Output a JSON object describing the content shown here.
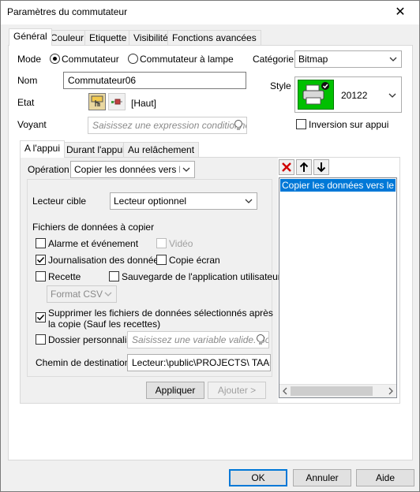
{
  "window": {
    "title": "Paramètres du commutateur",
    "close_glyph": "✕"
  },
  "tabs": [
    {
      "label": "Général",
      "active": true
    },
    {
      "label": "Couleur"
    },
    {
      "label": "Etiquette"
    },
    {
      "label": "Visibilité"
    },
    {
      "label": "Fonctions avancées"
    }
  ],
  "general": {
    "mode_label": "Mode",
    "mode_options": [
      "Commutateur",
      "Commutateur à lampe"
    ],
    "mode_selected": "Commutateur",
    "categorie_label": "Catégorie",
    "categorie_value": "Bitmap",
    "nom_label": "Nom",
    "nom_value": "Commutateur06",
    "style_label": "Style",
    "style_value": "20122",
    "etat_label": "Etat",
    "etat_value": "[Haut]",
    "voyant_label": "Voyant",
    "voyant_placeholder": "Saisissez une expression conditionne",
    "inversion_label": "Inversion sur appui"
  },
  "action_tabs": [
    {
      "label": "A l'appui",
      "active": true
    },
    {
      "label": "Durant l'appui"
    },
    {
      "label": "Au relâchement"
    }
  ],
  "action": {
    "operation_label": "Opération",
    "operation_value": "Copier les données vers le le",
    "lecteur_label": "Lecteur cible",
    "lecteur_value": "Lecteur optionnel",
    "fichiers_label": "Fichiers de données à copier",
    "checkboxes": {
      "alarme": {
        "label": "Alarme et événement",
        "checked": false
      },
      "video": {
        "label": "Vidéo",
        "checked": false,
        "disabled": true
      },
      "journalisation": {
        "label": "Journalisation des données",
        "checked": true
      },
      "copie_ecran": {
        "label": "Copie écran",
        "checked": false
      },
      "recette": {
        "label": "Recette",
        "checked": false
      },
      "sauvegarde": {
        "label": "Sauvegarde de l'application utilisateur",
        "checked": false
      },
      "supprimer": {
        "label_line1": "Supprimer les fichiers de données sélectionnés après",
        "label_line2": "la copie (Sauf les recettes)",
        "checked": true
      },
      "dossier": {
        "label": "Dossier personnalisé",
        "checked": false
      }
    },
    "format_value": "Format CSV",
    "dossier_placeholder": "Saisissez une variable valide. So",
    "chemin_label": "Chemin de destination:",
    "chemin_value": "Lecteur:\\public\\PROJECTS\\ TAAONE",
    "appliquer_label": "Appliquer",
    "ajouter_label": "Ajouter >"
  },
  "list": {
    "items": [
      "Copier les données vers le lect"
    ],
    "selected_index": 0
  },
  "footer": {
    "ok_label": "OK",
    "annuler_label": "Annuler",
    "aide_label": "Aide"
  },
  "colors": {
    "selection": "#0078d7",
    "style_bg": "#00c000",
    "delete_red": "#d00000",
    "default_border": "#0078d7"
  }
}
